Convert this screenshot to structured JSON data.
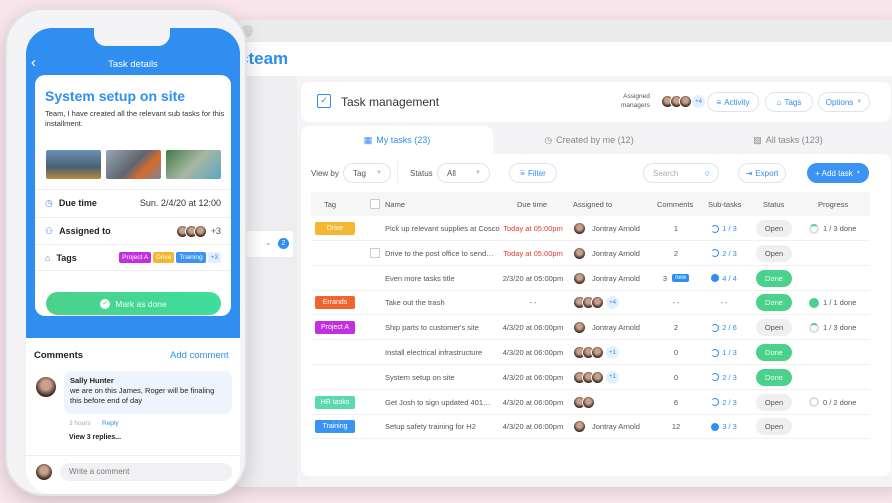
{
  "app": {
    "logo": "cteam",
    "sidebar_badge": "2"
  },
  "header": {
    "title": "Task management",
    "assigned_label_1": "Assigned",
    "assigned_label_2": "managers",
    "managers_more": "+4",
    "activity": "Activity",
    "tags": "Tags",
    "options": "Options"
  },
  "tabs": [
    {
      "label": "My tasks (23)",
      "active": true
    },
    {
      "label": "Created by me (12)"
    },
    {
      "label": "All tasks (123)"
    }
  ],
  "toolbar": {
    "view_by_label": "View by",
    "view_by_value": "Tag",
    "status_label": "Status",
    "status_value": "All",
    "filter": "Filter",
    "search_placeholder": "Search",
    "export": "Export",
    "add_task": "+ Add task"
  },
  "columns": {
    "tag": "Tag",
    "name": "Name",
    "due": "Due time",
    "assigned": "Assigned to",
    "comments": "Comments",
    "subtasks": "Sub-tasks",
    "status": "Status",
    "progress": "Progress"
  },
  "colors": {
    "accent": "#2f8ef0",
    "done": "#4cd18a",
    "overdue": "#e53935"
  },
  "rows": [
    {
      "tag": "Drive",
      "tag_color": "#f5b731",
      "name": "Pick up relevant supplies at Cosco",
      "due": "Today at 05:00pm",
      "overdue": true,
      "assignee": "Jontray Arnold",
      "avatars": 1,
      "comments": "1",
      "subtasks": "1 / 3",
      "status": "Open",
      "progress": "1 / 3 done"
    },
    {
      "name": "Drive to the post office to send…",
      "checkbox": true,
      "due": "Today at 05:00pm",
      "overdue": true,
      "assignee": "Jontray Arnold",
      "avatars": 1,
      "comments": "2",
      "subtasks": "2 / 3",
      "status": "Open"
    },
    {
      "name": "Even more tasks title",
      "due": "2/3/20 at 05:00pm",
      "assignee": "Jontray Arnold",
      "avatars": 1,
      "comments": "3",
      "new_badge": "new",
      "subtasks": "4 / 4",
      "subtasks_done": true,
      "status": "Done"
    },
    {
      "tag": "Errands",
      "tag_color": "#f0642d",
      "name": "Take out the trash",
      "due": "- -",
      "avatars": 3,
      "more": "+4",
      "comments": "- -",
      "subtasks": "- -",
      "status": "Done",
      "progress": "1 / 1 done",
      "progress_done": true
    },
    {
      "tag": "Project A",
      "tag_color": "#c22fe0",
      "name": "Ship parts to customer's site",
      "due": "4/3/20 at 06:00pm",
      "assignee": "Jontray Arnold",
      "avatars": 1,
      "comments": "2",
      "subtasks": "2 / 6",
      "status": "Open",
      "progress": "1 / 3 done"
    },
    {
      "name": "Install electrical infrastructure",
      "due": "4/3/20 at 06:00pm",
      "avatars": 3,
      "more": "+1",
      "comments": "0",
      "subtasks": "1 / 3",
      "status": "Done"
    },
    {
      "name": "System setup on site",
      "due": "4/3/20 at 06:00pm",
      "avatars": 3,
      "more": "+1",
      "comments": "0",
      "subtasks": "2 / 3",
      "status": "Done"
    },
    {
      "tag": "HR tasks",
      "tag_color": "#5ad8b0",
      "name": "Get Josh to sign updated 401…",
      "due": "4/3/20 at 06:00pm",
      "avatars": 2,
      "comments": "6",
      "subtasks": "2 / 3",
      "status": "Open",
      "progress": "0 / 2 done",
      "progress_empty": true
    },
    {
      "tag": "Training",
      "tag_color": "#3b94f3",
      "name": "Setup safety training for H2",
      "due": "4/3/20 at 06:00pm",
      "assignee": "Jontray Arnold",
      "avatars": 1,
      "comments": "12",
      "subtasks": "3 / 3",
      "subtasks_done": true,
      "status": "Open"
    }
  ],
  "phone": {
    "nav_title": "Task details",
    "task_title": "System setup on site",
    "description": "Team, I have created all the relevant sub tasks for this installment.",
    "due_label": "Due time",
    "due_value": "Sun. 2/4/20 at 12:00",
    "assigned_label": "Assigned to",
    "assigned_more": "+3",
    "tags_label": "Tags",
    "tags": [
      "Project A",
      "Drive",
      "Training",
      "+3"
    ],
    "mark_done": "Mark as done",
    "comments_title": "Comments",
    "add_comment": "Add comment",
    "comment_author": "Sally Hunter",
    "comment_text": "we are on this James, Roger will be finaling this before end of day",
    "comment_time": "3 hours",
    "reply": "Reply",
    "view_replies": "View 3 replies...",
    "write_placeholder": "Write a comment"
  }
}
